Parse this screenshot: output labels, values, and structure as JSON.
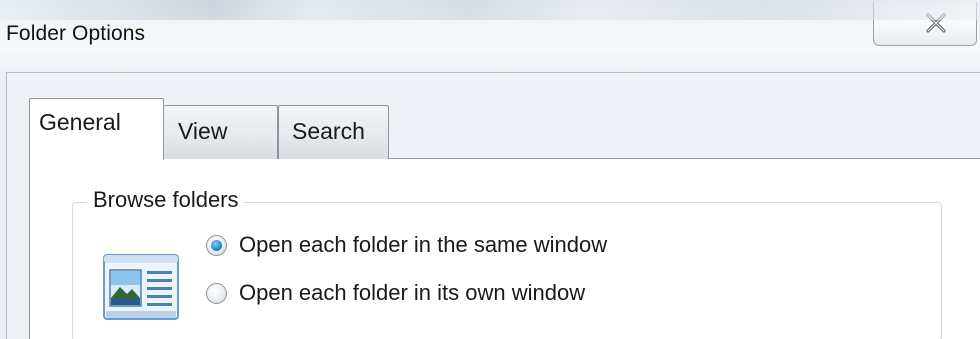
{
  "window": {
    "title": "Folder Options",
    "close_icon": "close-icon"
  },
  "tabs": [
    {
      "label": "General",
      "selected": true
    },
    {
      "label": "View",
      "selected": false
    },
    {
      "label": "Search",
      "selected": false
    }
  ],
  "browse_folders": {
    "label": "Browse folders",
    "illustration_icon": "folder-window-icon",
    "options": [
      {
        "label": "Open each folder in the same window",
        "checked": true
      },
      {
        "label": "Open each folder in its own window",
        "checked": false
      }
    ]
  },
  "colors": {
    "radio_selected": "#2a8fd0",
    "tab_border": "#8d959f",
    "icon_frame": "#6b9ccb"
  }
}
